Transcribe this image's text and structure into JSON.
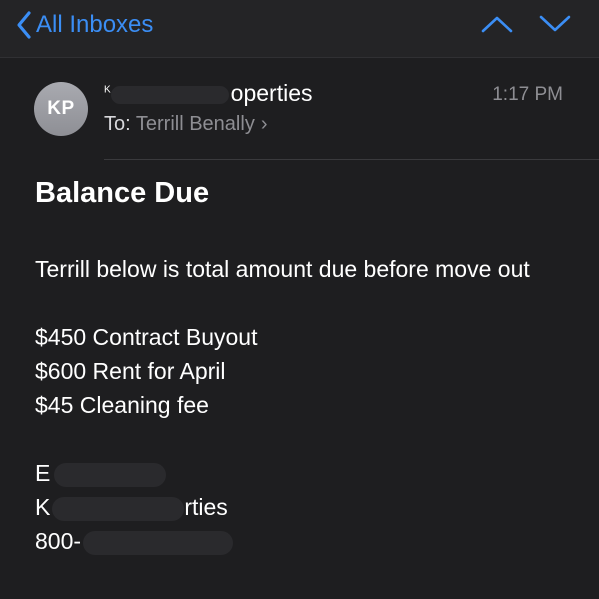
{
  "navbar": {
    "back_label": "All Inboxes",
    "up_icon": "chevron-up-icon",
    "down_icon": "chevron-down-icon",
    "accent_color": "#3b8ef5"
  },
  "message": {
    "avatar_initials": "KP",
    "sender_visible_prefix": "K",
    "sender_visible_suffix": "operties",
    "time": "1:17 PM",
    "to_label": "To:",
    "recipient": "Terrill Benally",
    "subject": "Balance Due",
    "body_intro": "Terrill below is total amount due before move out",
    "line_items": [
      "$450 Contract Buyout",
      "$600 Rent for April",
      "$45 Cleaning fee"
    ],
    "signature": {
      "line1_prefix": "E",
      "line2_prefix": "K",
      "line2_suffix": "rties",
      "line3_prefix": "800-"
    }
  }
}
